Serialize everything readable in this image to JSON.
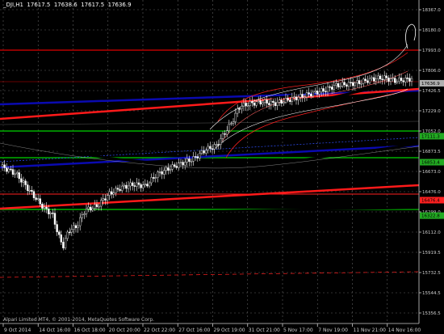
{
  "header": {
    "symbol": "_DJI,H1",
    "ohlc": "17617.5  17638.6  17617.5  17636.9"
  },
  "footer": {
    "copyright": "Alpari Limited MT4, © 2001-2014, MetaQuotes Software Corp."
  },
  "chart_data": {
    "type": "candlestick",
    "x_ticks": [
      "9 Oct 2014",
      "14 Oct 16:00",
      "16 Oct 18:00",
      "20 Oct 20:00",
      "22 Oct 22:00",
      "27 Oct 16:00",
      "29 Oct 19:00",
      "31 Oct 21:00",
      "5 Nov 17:00",
      "7 Nov 19:00",
      "11 Nov 21:00",
      "14 Nov 16:00"
    ],
    "y_ticks": [
      "18367.0",
      "18180.0",
      "17993.0",
      "17806.0",
      "17426.5",
      "17229.0",
      "17052.0",
      "16873.5",
      "16673.0",
      "16476.0",
      "16299.0",
      "16112.0",
      "15919.5",
      "15732.5",
      "15544.5",
      "15356.5"
    ],
    "price_labels": [
      {
        "text": "17636.9",
        "bg": "#b0b0b0",
        "fg": "#000000",
        "value": 17636.9
      },
      {
        "text": "17111.3",
        "bg": "#22aa22",
        "fg": "#000000",
        "value": 17111.3
      },
      {
        "text": "16853.4",
        "bg": "#22aa22",
        "fg": "#000000",
        "value": 16853.4
      },
      {
        "text": "16476.4",
        "bg": "#ff2020",
        "fg": "#000000",
        "value": 16476.4
      },
      {
        "text": "16322.8",
        "bg": "#22aa22",
        "fg": "#000000",
        "value": 16322.8
      }
    ],
    "colors": {
      "background": "#000000",
      "grid": "#606060",
      "bull_candle": "#000000",
      "bear_candle": "#ffffff",
      "candle_outline": "#ffffff"
    }
  }
}
